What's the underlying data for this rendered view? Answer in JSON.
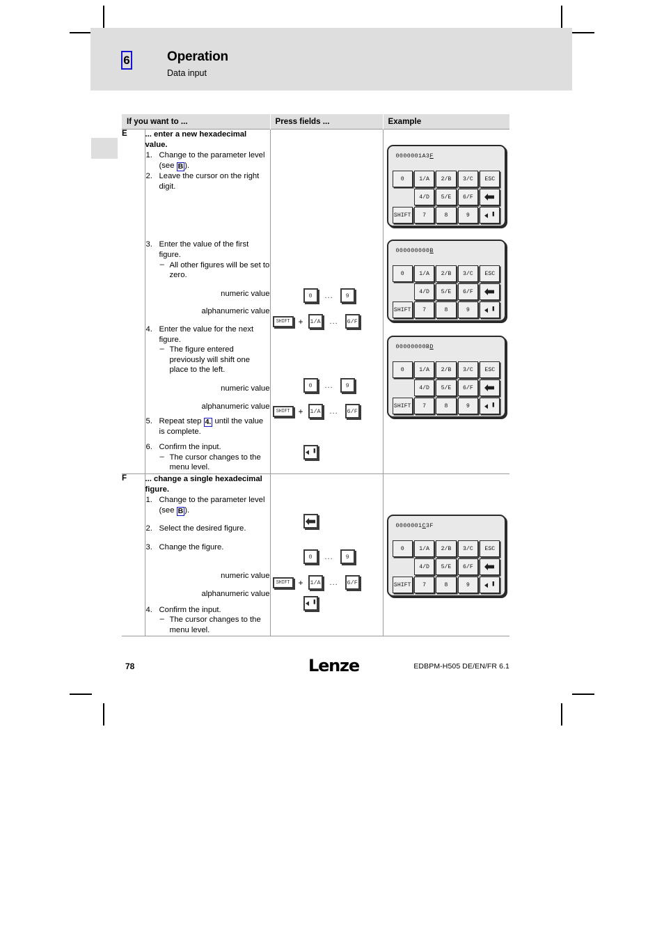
{
  "header": {
    "chapter_number": "6",
    "title": "Operation",
    "subtitle": "Data input"
  },
  "table": {
    "columns": {
      "want_to": "If you want to ...",
      "press_fields": "Press fields ...",
      "example": "Example"
    },
    "rows": [
      {
        "letter": "E",
        "lead": "... enter a new hexadecimal value.",
        "steps": [
          {
            "num": "1.",
            "text_before": "Change to the parameter level (see ",
            "xref": "B",
            "text_after": ")."
          },
          {
            "num": "2.",
            "text": "Leave the cursor on the right digit."
          },
          {
            "num": "3.",
            "text": "Enter the value of the first figure.",
            "sub": "All other figures will be set to zero."
          },
          {
            "num": "4.",
            "text": "Enter the value for the next figure.",
            "sub": "The figure entered previously will shift one place to the left."
          },
          {
            "num": "5.",
            "text_before": "Repeat step ",
            "xref": "4.",
            "text_after": " until the value is complete."
          },
          {
            "num": "6.",
            "text": "Confirm the input.",
            "sub": "The cursor changes to the menu level."
          }
        ],
        "numeric_label": "numeric value",
        "alphanumeric_label": "alphanumeric value"
      },
      {
        "letter": "F",
        "lead": "... change a single hexadecimal figure.",
        "steps": [
          {
            "num": "1.",
            "text_before": "Change to the parameter level (see ",
            "xref": "B",
            "text_after": ")."
          },
          {
            "num": "2.",
            "text": "Select the desired figure."
          },
          {
            "num": "3.",
            "text": "Change the figure."
          },
          {
            "num": "4.",
            "text": "Confirm the input.",
            "sub": "The cursor changes to the menu level."
          }
        ],
        "numeric_label": "numeric value",
        "alphanumeric_label": "alphanumeric value"
      }
    ]
  },
  "press_keys": {
    "shift": "SHIFT",
    "plus": "+",
    "ellipsis": "...",
    "numeric_from": "0",
    "numeric_to": "9",
    "alpha_from": "1/A",
    "alpha_to": "6/F",
    "enter_icon": "enter-key-icon",
    "left_arrow_icon": "left-arrow-key-icon"
  },
  "keypads": [
    {
      "display_prefix": "0000001A3",
      "display_cursor": "F",
      "display_suffix": "",
      "keys": [
        [
          "0",
          "1/A",
          "2/B",
          "3/C",
          "ESC"
        ],
        [
          "",
          "4/D",
          "5/E",
          "6/F",
          "left-arrow-icon"
        ],
        [
          "SHIFT",
          "7",
          "8",
          "9",
          "enter-icon"
        ]
      ]
    },
    {
      "display_prefix": "000000000",
      "display_cursor": "B",
      "display_suffix": "",
      "keys": [
        [
          "0",
          "1/A",
          "2/B",
          "3/C",
          "ESC"
        ],
        [
          "",
          "4/D",
          "5/E",
          "6/F",
          "left-arrow-icon"
        ],
        [
          "SHIFT",
          "7",
          "8",
          "9",
          "enter-icon"
        ]
      ]
    },
    {
      "display_prefix": "00000000B",
      "display_cursor": "D",
      "display_suffix": "",
      "keys": [
        [
          "0",
          "1/A",
          "2/B",
          "3/C",
          "ESC"
        ],
        [
          "",
          "4/D",
          "5/E",
          "6/F",
          "left-arrow-icon"
        ],
        [
          "SHIFT",
          "7",
          "8",
          "9",
          "enter-icon"
        ]
      ]
    },
    {
      "display_prefix": "0000001",
      "display_cursor": "C",
      "display_suffix": "3F",
      "keys": [
        [
          "0",
          "1/A",
          "2/B",
          "3/C",
          "ESC"
        ],
        [
          "",
          "4/D",
          "5/E",
          "6/F",
          "left-arrow-icon"
        ],
        [
          "SHIFT",
          "7",
          "8",
          "9",
          "enter-icon"
        ]
      ]
    }
  ],
  "footer": {
    "page_number": "78",
    "logo": "Lenze",
    "doc_code": "EDBPM-H505 DE/EN/FR 6.1"
  }
}
